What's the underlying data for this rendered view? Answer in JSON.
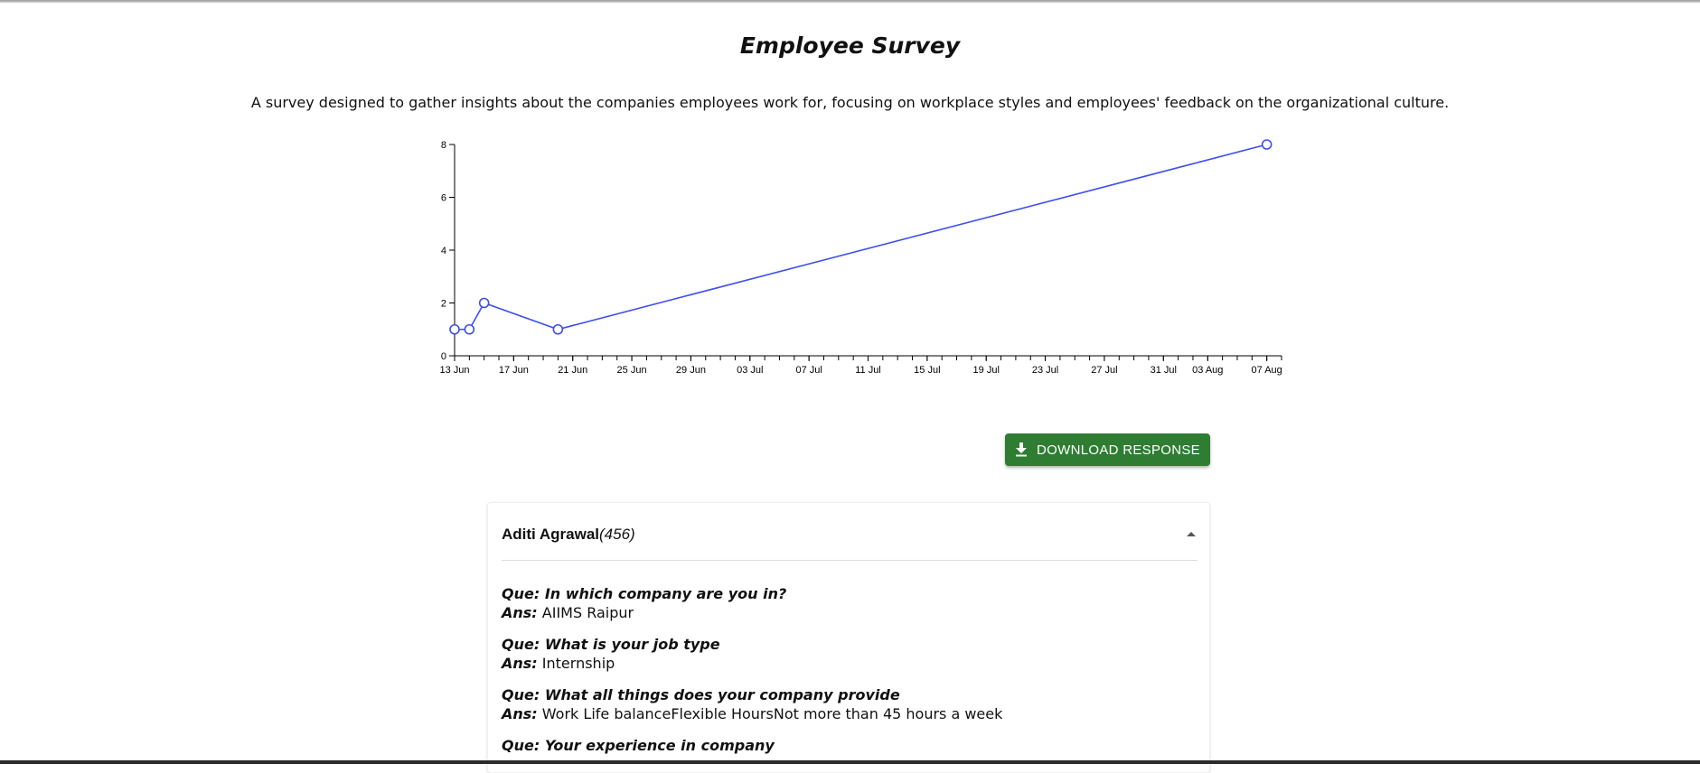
{
  "survey": {
    "title": "Employee Survey",
    "description": "A survey designed to gather insights about the companies employees work for, focusing on workplace styles and employees' feedback on the organizational culture."
  },
  "download": {
    "label": "DOWNLOAD RESPONSE",
    "color": "#2e7d32"
  },
  "response": {
    "name": "Aditi Agrawal",
    "id": "(456)",
    "questions": [
      {
        "q": "Que: In which company are you in?",
        "a_label": "Ans:",
        "a": "AIIMS Raipur"
      },
      {
        "q": "Que: What is your job type",
        "a_label": "Ans:",
        "a": "Internship"
      },
      {
        "q": "Que: What all things does your company provide",
        "a_label": "Ans:",
        "a": "Work Life balanceFlexible HoursNot more than 45 hours a week"
      },
      {
        "q": "Que: Your experience in company",
        "a_label": "",
        "a": ""
      }
    ]
  },
  "chart_data": {
    "type": "line",
    "title": "",
    "xlabel": "",
    "ylabel": "",
    "x": [
      "2023-06-13",
      "2023-06-14",
      "2023-06-15",
      "2023-06-20",
      "2023-08-07"
    ],
    "y": [
      1,
      1,
      2,
      1,
      8
    ],
    "ylim": [
      0,
      8
    ],
    "xlim": [
      "2023-06-13",
      "2023-08-08"
    ],
    "yticks": [
      0,
      2,
      4,
      6,
      8
    ],
    "xticks": [
      "2023-06-13",
      "2023-06-17",
      "2023-06-21",
      "2023-06-25",
      "2023-06-29",
      "2023-07-03",
      "2023-07-07",
      "2023-07-11",
      "2023-07-15",
      "2023-07-19",
      "2023-07-23",
      "2023-07-27",
      "2023-07-31",
      "2023-08-03",
      "2023-08-07"
    ],
    "xtick_labels": [
      "13 Jun",
      "17 Jun",
      "21 Jun",
      "25 Jun",
      "29 Jun",
      "03 Jul",
      "07 Jul",
      "11 Jul",
      "15 Jul",
      "19 Jul",
      "23 Jul",
      "27 Jul",
      "31 Jul",
      "03 Aug",
      "07 Aug"
    ],
    "line_color": "#3d4fea",
    "grid": false
  }
}
